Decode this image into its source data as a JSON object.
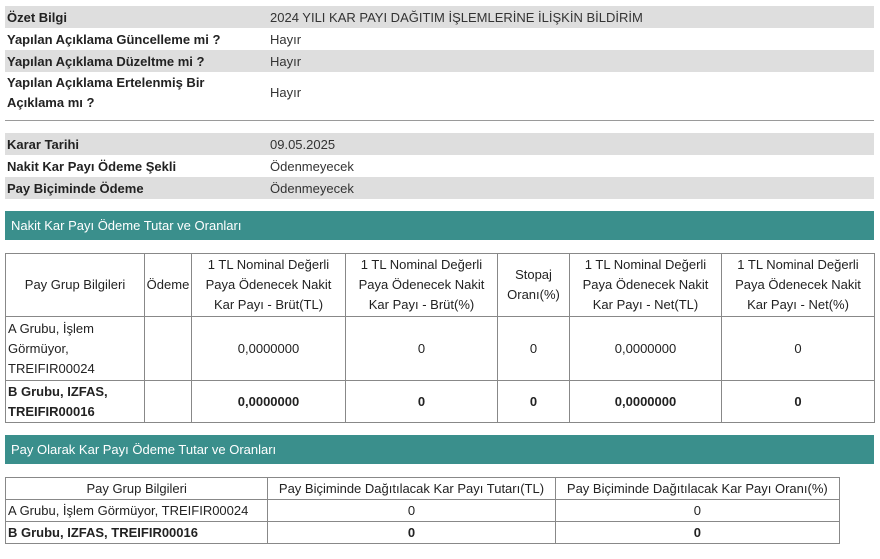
{
  "summary": {
    "rows": [
      {
        "label": "Özet Bilgi",
        "value": "2024 YILI KAR PAYI DAĞITIM İŞLEMLERİNE İLİŞKİN BİLDİRİM"
      },
      {
        "label": "Yapılan Açıklama Güncelleme mi ?",
        "value": "Hayır"
      },
      {
        "label": "Yapılan Açıklama Düzeltme mi ?",
        "value": "Hayır"
      },
      {
        "label": "Yapılan Açıklama Ertelenmiş Bir Açıklama mı ?",
        "value": "Hayır"
      }
    ]
  },
  "decision": {
    "rows": [
      {
        "label": "Karar Tarihi",
        "value": "09.05.2025"
      },
      {
        "label": "Nakit Kar Payı Ödeme Şekli",
        "value": "Ödenmeyecek"
      },
      {
        "label": "Pay Biçiminde Ödeme",
        "value": "Ödenmeyecek"
      }
    ]
  },
  "cash": {
    "title": "Nakit Kar Payı Ödeme Tutar ve Oranları",
    "headers": [
      "Pay Grup Bilgileri",
      "Ödeme",
      "1 TL Nominal Değerli Paya Ödenecek Nakit Kar Payı - Brüt(TL)",
      "1 TL Nominal Değerli Paya Ödenecek Nakit Kar Payı - Brüt(%)",
      "Stopaj Oranı(%)",
      "1 TL Nominal Değerli Paya Ödenecek Nakit Kar Payı - Net(TL)",
      "1 TL Nominal Değerli Paya Ödenecek Nakit Kar Payı - Net(%)"
    ],
    "rows": [
      {
        "group": "A Grubu, İşlem Görmüyor, TREIFIR00024",
        "payment": "",
        "gross_tl": "0,0000000",
        "gross_pct": "0",
        "stopaj": "0",
        "net_tl": "0,0000000",
        "net_pct": "0"
      },
      {
        "group": "B Grubu, IZFAS, TREIFIR00016",
        "payment": "",
        "gross_tl": "0,0000000",
        "gross_pct": "0",
        "stopaj": "0",
        "net_tl": "0,0000000",
        "net_pct": "0"
      }
    ]
  },
  "share": {
    "title": "Pay Olarak Kar Payı Ödeme Tutar ve Oranları",
    "headers": [
      "Pay Grup Bilgileri",
      "Pay Biçiminde Dağıtılacak Kar Payı Tutarı(TL)",
      "Pay Biçiminde Dağıtılacak Kar Payı Oranı(%)"
    ],
    "rows": [
      {
        "group": "A Grubu, İşlem Görmüyor, TREIFIR00024",
        "amount": "0",
        "ratio": "0"
      },
      {
        "group": "B Grubu, IZFAS, TREIFIR00016",
        "amount": "0",
        "ratio": "0"
      }
    ]
  }
}
